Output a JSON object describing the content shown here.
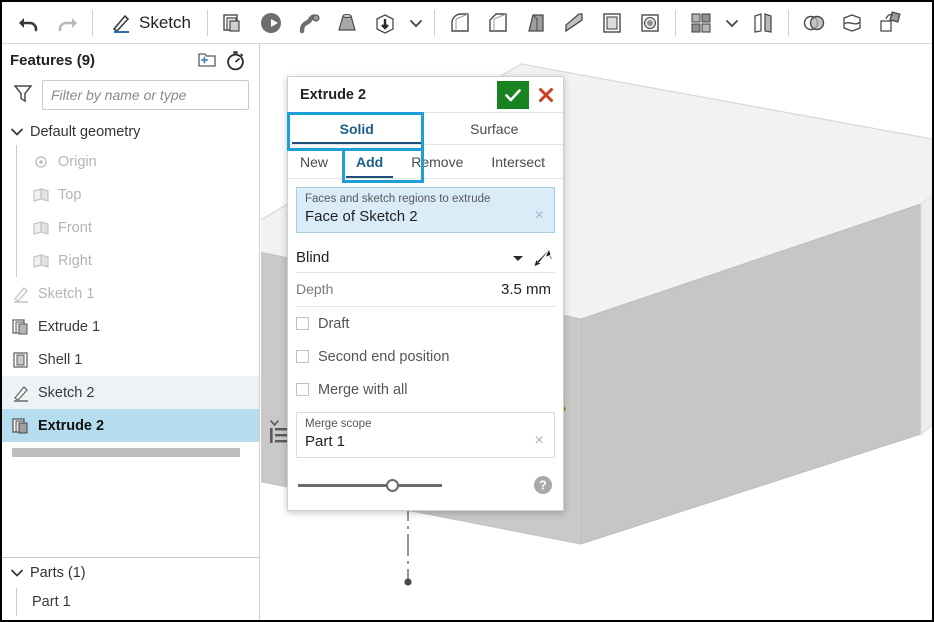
{
  "toolbar": {
    "undo_label": "Undo",
    "redo_label": "Redo",
    "sketch_label": "Sketch",
    "icons": [
      {
        "name": "undo-icon",
        "label": "Undo"
      },
      {
        "name": "redo-icon",
        "label": "Redo"
      },
      {
        "name": "sketch-icon",
        "label": "Sketch"
      },
      {
        "name": "extrude-icon",
        "label": "Extrude"
      },
      {
        "name": "revolve-icon",
        "label": "Revolve"
      },
      {
        "name": "sweep-icon",
        "label": "Sweep"
      },
      {
        "name": "loft-icon",
        "label": "Loft"
      },
      {
        "name": "thicken-icon",
        "label": "Thicken"
      },
      {
        "name": "chevron-down-icon",
        "label": "More"
      },
      {
        "name": "fillet-icon",
        "label": "Fillet"
      },
      {
        "name": "chamfer-icon",
        "label": "Chamfer"
      },
      {
        "name": "draft-icon",
        "label": "Draft"
      },
      {
        "name": "rib-icon",
        "label": "Rib"
      },
      {
        "name": "shell-icon",
        "label": "Shell"
      },
      {
        "name": "hole-icon",
        "label": "Hole"
      },
      {
        "name": "pattern-icon",
        "label": "Linear pattern"
      },
      {
        "name": "chevron-down-icon-2",
        "label": "More patterns"
      },
      {
        "name": "mirror-icon",
        "label": "Mirror"
      },
      {
        "name": "boolean-icon",
        "label": "Boolean"
      },
      {
        "name": "split-icon",
        "label": "Split"
      },
      {
        "name": "transform-icon",
        "label": "Transform"
      }
    ]
  },
  "sidebar": {
    "title": "Features (9)",
    "add_folder_label": "Create folder",
    "rollback_label": "Rollback history",
    "filter_placeholder": "Filter by name or type",
    "filter_value": "",
    "tree": [
      {
        "label": "Default geometry",
        "icon": "chevron-down-icon",
        "type": "group",
        "state": "normal"
      },
      {
        "label": "Origin",
        "icon": "origin-icon",
        "type": "child",
        "state": "dim"
      },
      {
        "label": "Top",
        "icon": "plane-icon",
        "type": "child",
        "state": "dim"
      },
      {
        "label": "Front",
        "icon": "plane-icon",
        "type": "child",
        "state": "dim"
      },
      {
        "label": "Right",
        "icon": "plane-icon",
        "type": "child",
        "state": "dim"
      },
      {
        "label": "Sketch 1",
        "icon": "sketch-icon",
        "type": "item",
        "state": "dim"
      },
      {
        "label": "Extrude 1",
        "icon": "extrude-icon",
        "type": "item",
        "state": "normal"
      },
      {
        "label": "Shell 1",
        "icon": "shell-icon",
        "type": "item",
        "state": "normal"
      },
      {
        "label": "Sketch 2",
        "icon": "sketch-icon",
        "type": "item",
        "state": "sel-light"
      },
      {
        "label": "Extrude 2",
        "icon": "extrude-icon",
        "type": "item",
        "state": "sel-strong"
      }
    ],
    "parts": {
      "title": "Parts (1)",
      "items": [
        {
          "label": "Part 1"
        }
      ]
    }
  },
  "dialog": {
    "title": "Extrude 2",
    "accept_label": "Accept",
    "cancel_label": "Cancel",
    "tabs": [
      {
        "label": "Solid",
        "active": true
      },
      {
        "label": "Surface",
        "active": false
      }
    ],
    "subtabs": [
      {
        "label": "New",
        "active": false
      },
      {
        "label": "Add",
        "active": true
      },
      {
        "label": "Remove",
        "active": false
      },
      {
        "label": "Intersect",
        "active": false
      }
    ],
    "selection": {
      "label": "Faces and sketch regions to extrude",
      "value": "Face of Sketch 2",
      "clear_label": "×"
    },
    "end_type": {
      "value": "Blind",
      "caret": "▾",
      "flip_label": "Flip direction"
    },
    "depth": {
      "label": "Depth",
      "value": "3.5 mm"
    },
    "checkboxes": [
      {
        "label": "Draft",
        "checked": false
      },
      {
        "label": "Second end position",
        "checked": false
      },
      {
        "label": "Merge with all",
        "checked": false
      }
    ],
    "merge_scope": {
      "label": "Merge scope",
      "value": "Part 1",
      "clear_label": "×"
    },
    "slider": {
      "value": 61,
      "label": "Opacity"
    },
    "help_label": "Help"
  },
  "highlights": [
    {
      "name": "highlight-solid-tab",
      "color": "#1f9fd8"
    },
    {
      "name": "highlight-add-subtab",
      "color": "#1f9fd8"
    }
  ],
  "colors": {
    "accept_green": "#1a8321",
    "cancel_red": "#cf3b25",
    "selection_blue": "#d9ecf7",
    "tree_selected": "#b6dcf0",
    "annotation_blue": "#1f9fd8",
    "sketch_orange": "#f0a416"
  }
}
